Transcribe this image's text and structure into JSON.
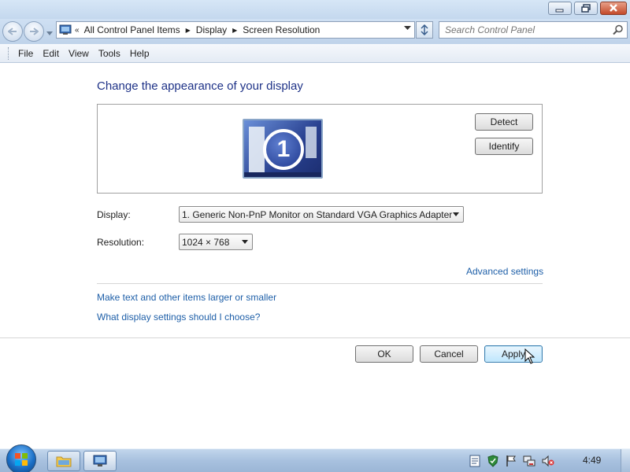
{
  "window": {
    "breadcrumb": [
      "All Control Panel Items",
      "Display",
      "Screen Resolution"
    ],
    "search_placeholder": "Search Control Panel"
  },
  "menu": [
    "File",
    "Edit",
    "View",
    "Tools",
    "Help"
  ],
  "main": {
    "heading": "Change the appearance of your display",
    "monitor_number": "1",
    "detect_label": "Detect",
    "identify_label": "Identify",
    "display_label": "Display:",
    "display_value": "1. Generic Non-PnP Monitor on Standard VGA Graphics Adapter",
    "resolution_label": "Resolution:",
    "resolution_value": "1024 × 768",
    "advanced_link": "Advanced settings",
    "text_size_link": "Make text and other items larger or smaller",
    "help_link": "What display settings should I choose?"
  },
  "buttons": {
    "ok": "OK",
    "cancel": "Cancel",
    "apply": "Apply"
  },
  "taskbar": {
    "clock": "4:49"
  },
  "colors": {
    "heading": "#1e3287",
    "link": "#1e5fa8",
    "taskbar": "#a8c1df"
  }
}
